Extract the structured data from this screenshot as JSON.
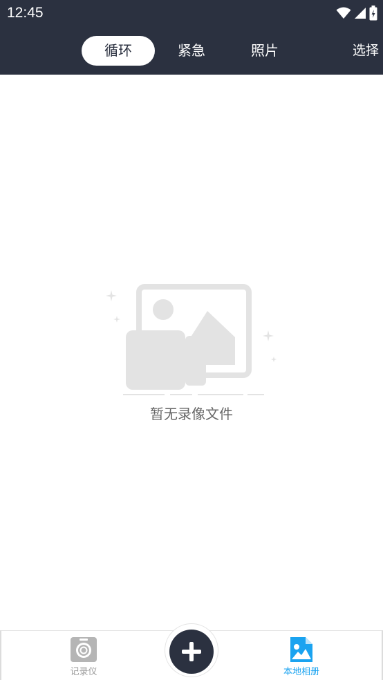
{
  "status_bar": {
    "time": "12:45"
  },
  "tabs": [
    {
      "label": "循环",
      "active": true
    },
    {
      "label": "紧急",
      "active": false
    },
    {
      "label": "照片",
      "active": false
    }
  ],
  "header": {
    "select_label": "选择"
  },
  "empty_state": {
    "message": "暂无录像文件"
  },
  "bottom_nav": {
    "items": [
      {
        "label": "记录仪",
        "icon": "camera-icon",
        "active": false
      },
      {
        "label": "本地相册",
        "icon": "gallery-icon",
        "active": true
      }
    ],
    "add_icon": "plus-icon"
  },
  "colors": {
    "header_bg": "#2b3140",
    "accent": "#1aa3f0",
    "placeholder_gray": "#e3e3e3"
  }
}
